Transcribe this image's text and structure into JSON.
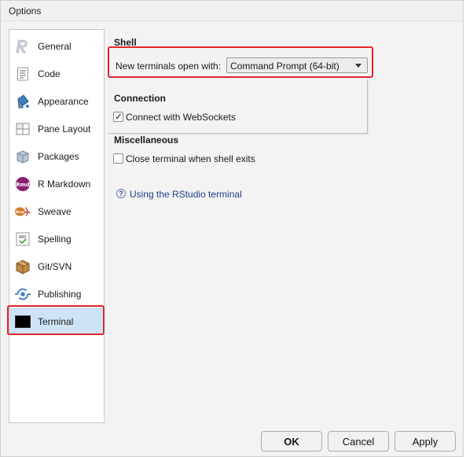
{
  "window": {
    "title": "Options"
  },
  "sidebar": {
    "items": [
      {
        "label": "General",
        "icon": "r-logo-icon"
      },
      {
        "label": "Code",
        "icon": "code-document-icon"
      },
      {
        "label": "Appearance",
        "icon": "paint-bucket-icon"
      },
      {
        "label": "Pane Layout",
        "icon": "pane-layout-icon"
      },
      {
        "label": "Packages",
        "icon": "package-box-icon"
      },
      {
        "label": "R Markdown",
        "icon": "rmd-icon"
      },
      {
        "label": "Sweave",
        "icon": "sweave-pdf-icon"
      },
      {
        "label": "Spelling",
        "icon": "spellcheck-icon"
      },
      {
        "label": "Git/SVN",
        "icon": "git-box-icon"
      },
      {
        "label": "Publishing",
        "icon": "publishing-icon"
      },
      {
        "label": "Terminal",
        "icon": "terminal-icon",
        "selected": true
      }
    ],
    "rmd_icon_text": "Rmd",
    "sweave_icon_text": "Rnw",
    "spell_icon_text": "ABC"
  },
  "shell": {
    "title": "Shell",
    "open_with_label": "New terminals open with:",
    "open_with_value": "Command Prompt (64-bit)"
  },
  "connection": {
    "title": "Connection",
    "websockets_label": "Connect with WebSockets",
    "websockets_checked": true
  },
  "misc": {
    "title": "Miscellaneous",
    "close_terminal_label": "Close terminal when shell exits",
    "close_terminal_checked": false
  },
  "help": {
    "icon_glyph": "?",
    "link_text": "Using the RStudio terminal"
  },
  "buttons": {
    "ok": "OK",
    "cancel": "Cancel",
    "apply": "Apply"
  },
  "colors": {
    "highlight": "#e0262b",
    "selected_bg": "#cde4f7",
    "link": "#1f3f8f"
  }
}
